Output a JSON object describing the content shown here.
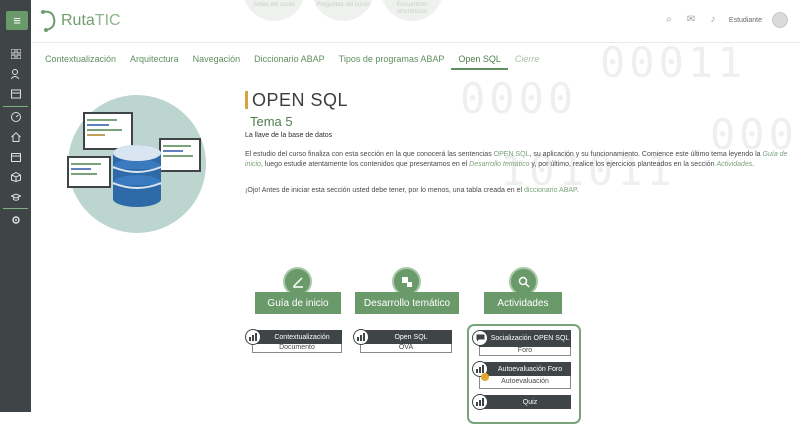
{
  "app": {
    "logo_text": "Ruta",
    "logo_accent": "TIC",
    "ghost_links": [
      "Antes del curso",
      "Preguntas del curso",
      "Encuentros sincrónicos"
    ],
    "user_name": "Estudiante"
  },
  "sidebar": {
    "items": [
      "grid-icon",
      "user-search-icon",
      "book-icon",
      "gauge-icon",
      "home-icon",
      "calendar-icon",
      "cube-icon",
      "graduation-icon",
      "gear-icon"
    ]
  },
  "tabs": [
    {
      "label": "Contextualización",
      "state": "normal"
    },
    {
      "label": "Arquitectura",
      "state": "normal"
    },
    {
      "label": "Navegación",
      "state": "normal"
    },
    {
      "label": "Diccionario ABAP",
      "state": "normal"
    },
    {
      "label": "Tipos de programas ABAP",
      "state": "normal"
    },
    {
      "label": "Open SQL",
      "state": "active"
    },
    {
      "label": "Cierre",
      "state": "disabled"
    }
  ],
  "content": {
    "title": "OPEN SQL",
    "subtitle": "Tema 5",
    "tagline": "La llave de la base de datos",
    "p1_a": "El estudio del curso finaliza con esta sección en la que conocerá las sentencias ",
    "p1_link1": "OPEN SQL",
    "p1_b": ", su aplicación y su funcionamiento. Comience este último tema leyendo la ",
    "p1_link2": "Guía de inicio",
    "p1_c": ", luego estudie atentamente los contenidos que presentamos en el ",
    "p1_link3": "Desarrollo temático",
    "p1_d": " y, por último, realice los ejercicios planteados en la sección ",
    "p1_link4": "Actividades",
    "p1_e": ".",
    "p2_a": "¡Ojo! Antes de iniciar esta sección usted debe tener, por lo menos, una tabla creada en el ",
    "p2_link": "diccionario ABAP",
    "p2_b": "."
  },
  "sections": {
    "guide": {
      "label": "Guía de inicio",
      "card_title": "Contextualización",
      "card_sub": "Documento"
    },
    "dev": {
      "label": "Desarrollo temático",
      "card_title": "Open SQL",
      "card_sub": "OVA"
    },
    "act": {
      "label": "Actividades",
      "cards": [
        {
          "title": "Socialización OPEN SQL",
          "sub": "Foro"
        },
        {
          "title": "Autoevaluación Foro",
          "sub": "Autoevaluación"
        },
        {
          "title": "Quiz",
          "sub": ""
        }
      ]
    }
  },
  "colors": {
    "brand_green": "#6a9a6a",
    "sidebar_dark": "#3f4446",
    "heading_accent": "#d4a441"
  }
}
